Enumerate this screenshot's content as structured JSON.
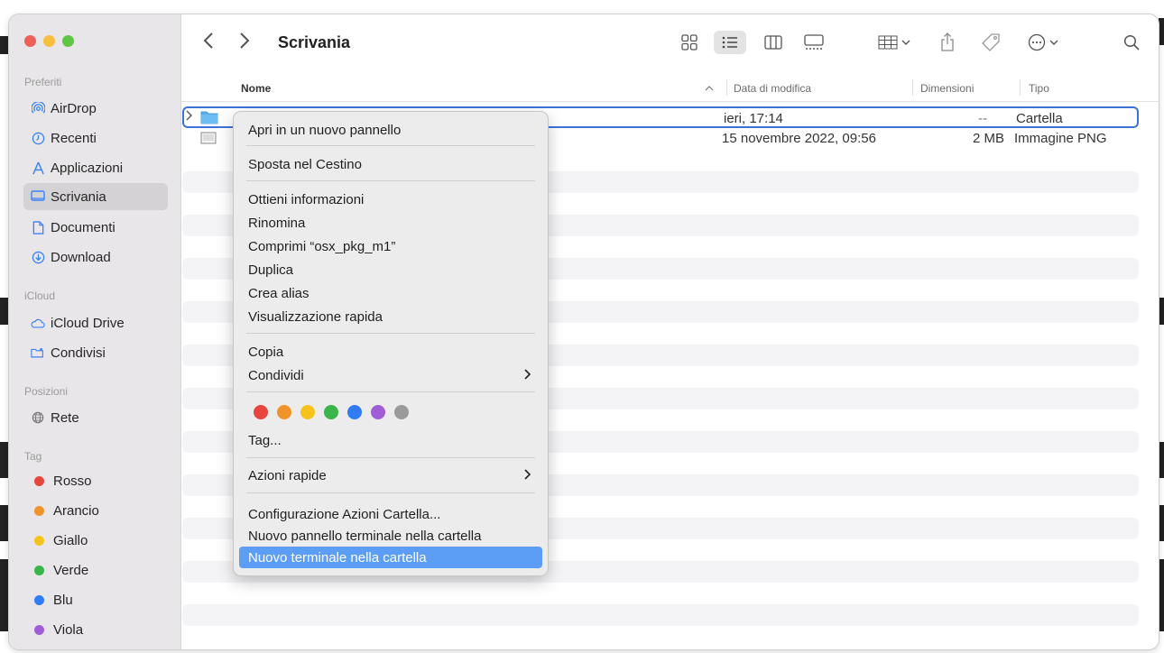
{
  "toolbar": {
    "title": "Scrivania"
  },
  "sidebar": {
    "preferiti_title": "Preferiti",
    "preferiti": [
      {
        "label": "AirDrop",
        "icon": "airdrop-icon"
      },
      {
        "label": "Recenti",
        "icon": "clock-icon"
      },
      {
        "label": "Applicazioni",
        "icon": "applications-icon"
      },
      {
        "label": "Scrivania",
        "icon": "desktop-icon"
      },
      {
        "label": "Documenti",
        "icon": "document-icon"
      },
      {
        "label": "Download",
        "icon": "download-icon"
      }
    ],
    "icloud_title": "iCloud",
    "icloud": [
      {
        "label": "iCloud Drive",
        "icon": "cloud-icon"
      },
      {
        "label": "Condivisi",
        "icon": "shared-folder-icon"
      }
    ],
    "posizioni_title": "Posizioni",
    "posizioni": [
      {
        "label": "Rete",
        "icon": "network-icon"
      }
    ],
    "tag_title": "Tag",
    "tags": [
      {
        "label": "Rosso",
        "color": "#e8453c"
      },
      {
        "label": "Arancio",
        "color": "#f0932b"
      },
      {
        "label": "Giallo",
        "color": "#f5c31b"
      },
      {
        "label": "Verde",
        "color": "#39b54a"
      },
      {
        "label": "Blu",
        "color": "#2f7cf6"
      },
      {
        "label": "Viola",
        "color": "#a05ed6"
      }
    ]
  },
  "columns": {
    "name": "Nome",
    "date": "Data di modifica",
    "size": "Dimensioni",
    "kind": "Tipo"
  },
  "files": [
    {
      "date": "ieri, 17:14",
      "size": "--",
      "kind": "Cartella"
    },
    {
      "date": "15 novembre 2022, 09:56",
      "size": "2 MB",
      "kind": "Immagine PNG"
    }
  ],
  "context_menu": {
    "items": [
      "Apri in un nuovo pannello",
      "Sposta nel Cestino",
      "Ottieni informazioni",
      "Rinomina",
      "Comprimi “osx_pkg_m1”",
      "Duplica",
      "Crea alias",
      "Visualizzazione rapida",
      "Copia",
      "Condividi",
      "Tag...",
      "Azioni rapide",
      "Configurazione Azioni Cartella...",
      "Nuovo pannello terminale nella cartella",
      "Nuovo terminale nella cartella"
    ],
    "tag_colors": [
      "#e8453c",
      "#f0932b",
      "#f5c31b",
      "#39b54a",
      "#2f7cf6",
      "#a05ed6",
      "#9a9a9a"
    ]
  }
}
